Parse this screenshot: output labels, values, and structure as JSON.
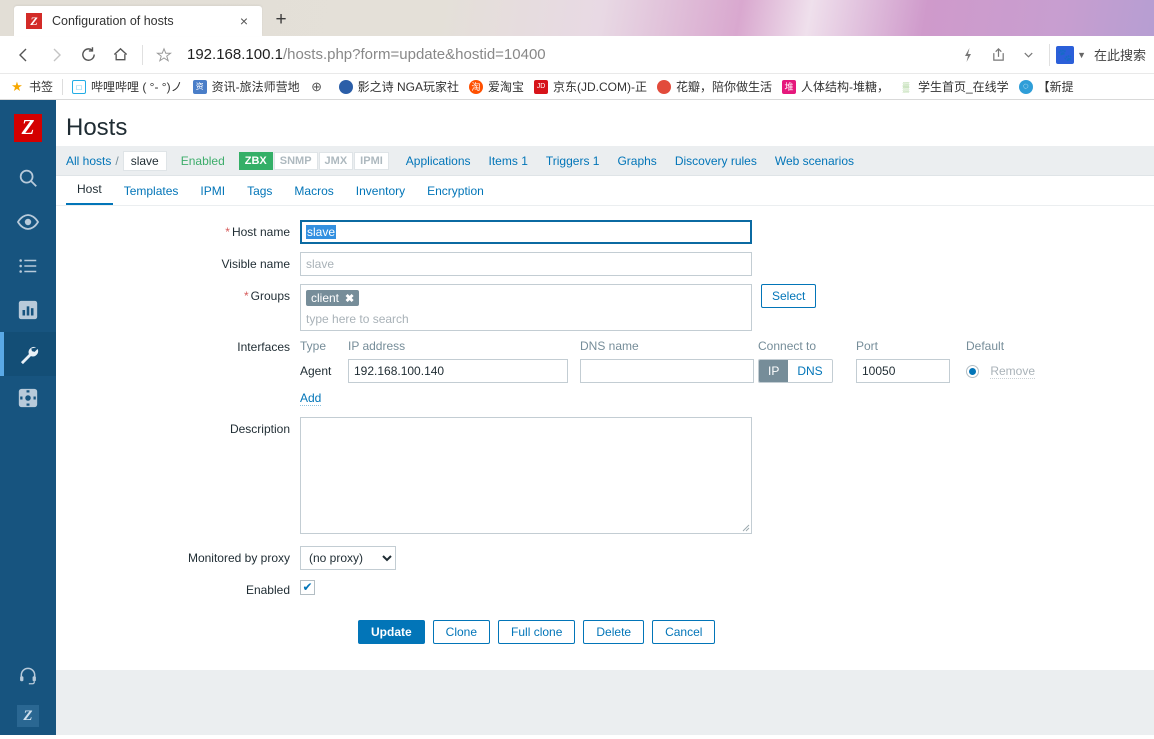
{
  "browser": {
    "tab": {
      "title": "Configuration of hosts",
      "favicon": "Z",
      "close_label": "×"
    },
    "newtab_label": "+",
    "nav": {
      "back": "back-arrow",
      "forward": "forward-arrow",
      "reload": "reload-icon",
      "home": "home-icon",
      "bookmark_star": "star-icon"
    },
    "url": {
      "host": "192.168.100.1",
      "path": "/hosts.php?form=update&hostid=10400"
    },
    "toolbar_right": {
      "lightning": "lightning-icon",
      "share": "share-icon",
      "chevron": "chevron-down-icon",
      "engine": "baidu-icon",
      "search_label": "在此搜索"
    },
    "bookmarks": [
      {
        "label": "书签",
        "icon": "star-icon",
        "color": "#f7a800"
      },
      {
        "label": "哔哩哔哩 ( °- °)ノ",
        "icon": "bilibili-icon",
        "color": "#23ade5"
      },
      {
        "label": "资讯-旅法师营地",
        "icon": "site-icon",
        "color": "#4a7ec8"
      },
      {
        "label": "",
        "icon": "globe-icon",
        "color": "#ffffff"
      },
      {
        "label": "影之诗 NGA玩家社",
        "icon": "nga-icon",
        "color": "#2b5ea8"
      },
      {
        "label": "爱淘宝",
        "icon": "taobao-icon",
        "color": "#ff5000"
      },
      {
        "label": "京东(JD.COM)-正",
        "icon": "jd-icon",
        "color": "#d7141a"
      },
      {
        "label": "花瓣，陪你做生活",
        "icon": "huaban-icon",
        "color": "#e24b3b"
      },
      {
        "label": "人体结构-堆糖，",
        "icon": "duitang-icon",
        "color": "#e5187c"
      },
      {
        "label": "学生首页_在线学",
        "icon": "study-icon",
        "color": "#6ab04c"
      },
      {
        "label": "【新提",
        "icon": "globe-blue-icon",
        "color": "#2f9ed8"
      }
    ]
  },
  "sidebar": {
    "logo": "Z",
    "items": [
      {
        "name": "search",
        "icon": "magnifier-icon",
        "active": false
      },
      {
        "name": "monitoring",
        "icon": "eye-icon",
        "active": false
      },
      {
        "name": "inventory",
        "icon": "list-icon",
        "active": false
      },
      {
        "name": "reports",
        "icon": "bar-chart-icon",
        "active": false
      },
      {
        "name": "configuration",
        "icon": "wrench-icon",
        "active": true
      },
      {
        "name": "administration",
        "icon": "gear-square-icon",
        "active": false
      }
    ],
    "bottom": {
      "support_icon": "headset-icon",
      "logo": "Z"
    }
  },
  "page": {
    "title": "Hosts"
  },
  "breadcrumb": {
    "all_hosts": "All hosts",
    "separator": "/",
    "current": "slave",
    "status": "Enabled",
    "badges": [
      {
        "label": "ZBX",
        "enabled": true
      },
      {
        "label": "SNMP",
        "enabled": false
      },
      {
        "label": "JMX",
        "enabled": false
      },
      {
        "label": "IPMI",
        "enabled": false
      }
    ],
    "links": [
      "Applications",
      "Items 1",
      "Triggers 1",
      "Graphs",
      "Discovery rules",
      "Web scenarios"
    ]
  },
  "form_tabs": [
    {
      "label": "Host",
      "active": true
    },
    {
      "label": "Templates",
      "active": false
    },
    {
      "label": "IPMI",
      "active": false
    },
    {
      "label": "Tags",
      "active": false
    },
    {
      "label": "Macros",
      "active": false
    },
    {
      "label": "Inventory",
      "active": false
    },
    {
      "label": "Encryption",
      "active": false
    }
  ],
  "form": {
    "host_name": {
      "label": "Host name",
      "required": true,
      "value": "slave",
      "selected": true
    },
    "visible_name": {
      "label": "Visible name",
      "required": false,
      "value": "",
      "placeholder": "slave"
    },
    "groups": {
      "label": "Groups",
      "required": true,
      "chips": [
        "client"
      ],
      "chip_remove": "✖",
      "placeholder": "type here to search",
      "select_button": "Select"
    },
    "interfaces": {
      "label": "Interfaces",
      "columns": [
        "Type",
        "IP address",
        "DNS name",
        "Connect to",
        "Port",
        "Default"
      ],
      "rows": [
        {
          "type": "Agent",
          "ip": "192.168.100.140",
          "dns": "",
          "connect_to": "IP",
          "connect_options": [
            "IP",
            "DNS"
          ],
          "port": "10050",
          "default": true,
          "remove_label": "Remove"
        }
      ],
      "add_label": "Add"
    },
    "description": {
      "label": "Description",
      "value": ""
    },
    "proxy": {
      "label": "Monitored by proxy",
      "value": "(no proxy)",
      "options": [
        "(no proxy)"
      ]
    },
    "enabled": {
      "label": "Enabled",
      "checked": true,
      "check_glyph": "✔"
    },
    "buttons": [
      {
        "label": "Update",
        "primary": true
      },
      {
        "label": "Clone",
        "primary": false
      },
      {
        "label": "Full clone",
        "primary": false
      },
      {
        "label": "Delete",
        "primary": false
      },
      {
        "label": "Cancel",
        "primary": false
      }
    ]
  },
  "colors": {
    "accent": "#0275b8",
    "sidebar": "#17547f",
    "badge_on": "#34af67",
    "required": "#d65b5b",
    "status_enabled": "#3dad6b",
    "chip": "#768d99",
    "page_bg": "#ebeef0"
  }
}
